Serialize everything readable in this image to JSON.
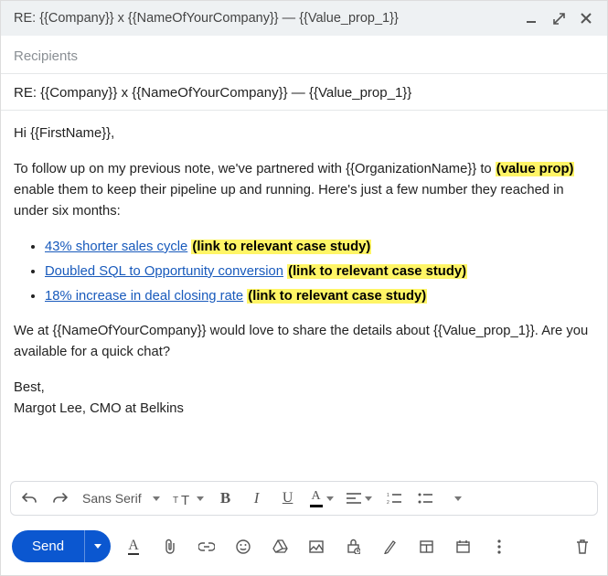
{
  "title": "RE: {{Company}} x {{NameOfYourCompany}} — {{Value_prop_1}}",
  "recipients_placeholder": "Recipients",
  "subject": "RE: {{Company}} x {{NameOfYourCompany}} — {{Value_prop_1}}",
  "body": {
    "greeting": "Hi {{FirstName}},",
    "intro1": "To follow up on my previous note, we've partnered with {{OrganizationName}} to ",
    "intro_highlight": "(value prop)",
    "intro2": " enable them to keep their pipeline up and running. Here's just a few number they reached in under six months:",
    "bullets": [
      {
        "link": "43% shorter sales cycle",
        "hl": "(link to relevant case study)"
      },
      {
        "link": "Doubled SQL to Opportunity conversion",
        "hl": "(link to relevant case study)"
      },
      {
        "link": "18% increase in deal closing rate",
        "hl": "(link to relevant case study)"
      }
    ],
    "outro": "We at {{NameOfYourCompany}} would love to share the details about {{Value_prop_1}}. Are you available for a quick chat?",
    "signoff1": "Best,",
    "signoff2": "Margot Lee, CMO at Belkins"
  },
  "toolbar": {
    "font": "Sans Serif",
    "bold": "B",
    "italic": "I",
    "underline": "U",
    "textcolor": "A"
  },
  "actions": {
    "send": "Send",
    "format_letter": "A"
  }
}
